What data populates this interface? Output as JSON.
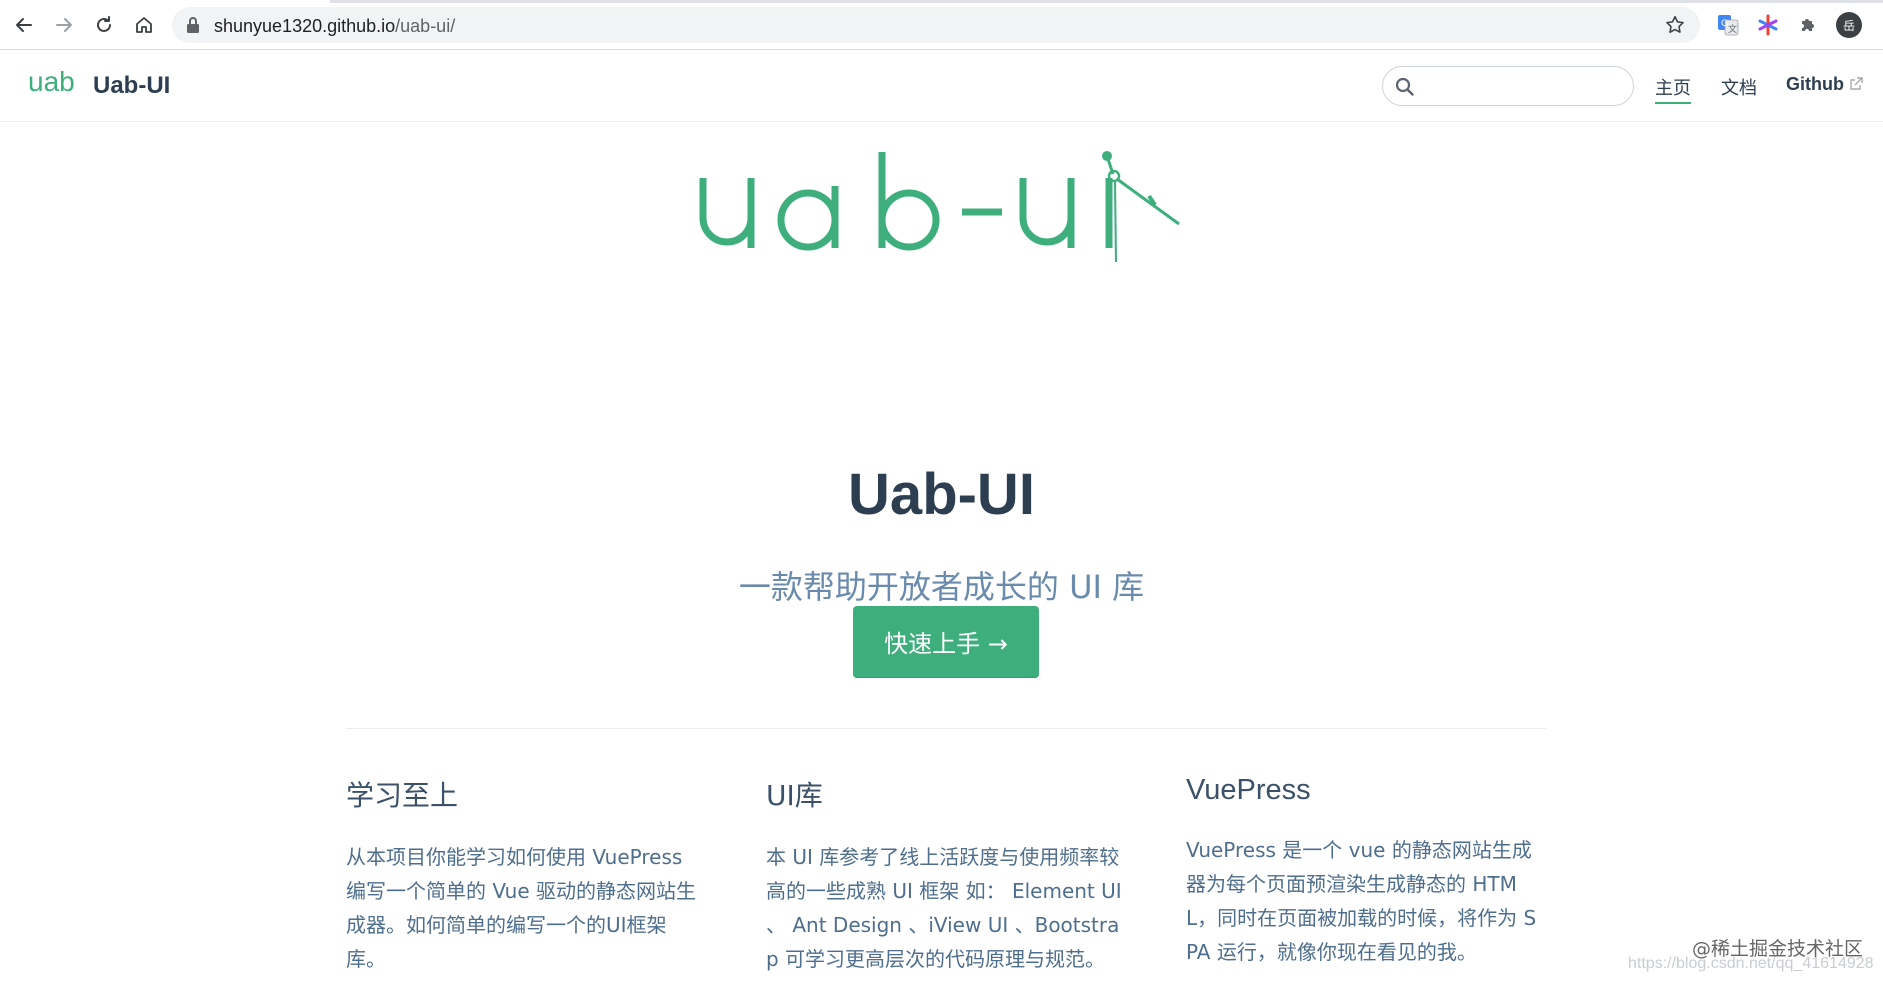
{
  "browser": {
    "url_host": "shunyue1320.github.io",
    "url_path": "/uab-ui/",
    "profile_initial": "岳"
  },
  "navbar": {
    "logo_text": "uab",
    "site_title": "Uab-UI",
    "search": {
      "value": "",
      "placeholder": ""
    },
    "links": [
      {
        "label": "主页",
        "active": true
      },
      {
        "label": "文档",
        "active": false
      },
      {
        "label": "Github",
        "external": true
      }
    ]
  },
  "hero": {
    "logo_text": "uab-ui",
    "title": "Uab-UI",
    "description": "一款帮助开放者成长的 UI 库",
    "action_label": "快速上手 →"
  },
  "features": [
    {
      "title": "学习至上",
      "details": "从本项目你能学习如何使用 VuePress 编写一个简单的 Vue 驱动的静态网站生成器。如何简单的编写一个的UI框架库。"
    },
    {
      "title": "UI库",
      "details": "本 UI 库参考了线上活跃度与使用频率较高的一些成熟 UI 框架 如： Element UI 、 Ant Design 、iView UI 、Bootstrap 可学习更高层次的代码原理与规范。"
    },
    {
      "title": "VuePress",
      "details": "VuePress 是一个 vue 的静态网站生成器为每个页面预渲染生成静态的 HTML，同时在页面被加载的时候，将作为 SPA 运行，就像你现在看见的我。"
    }
  ],
  "watermark": {
    "text": "@稀土掘金技术社区",
    "url": "https://blog.csdn.net/qq_41614928"
  },
  "colors": {
    "accent": "#3eaf7c",
    "text": "#2c3e50",
    "description": "#6a8bad"
  }
}
